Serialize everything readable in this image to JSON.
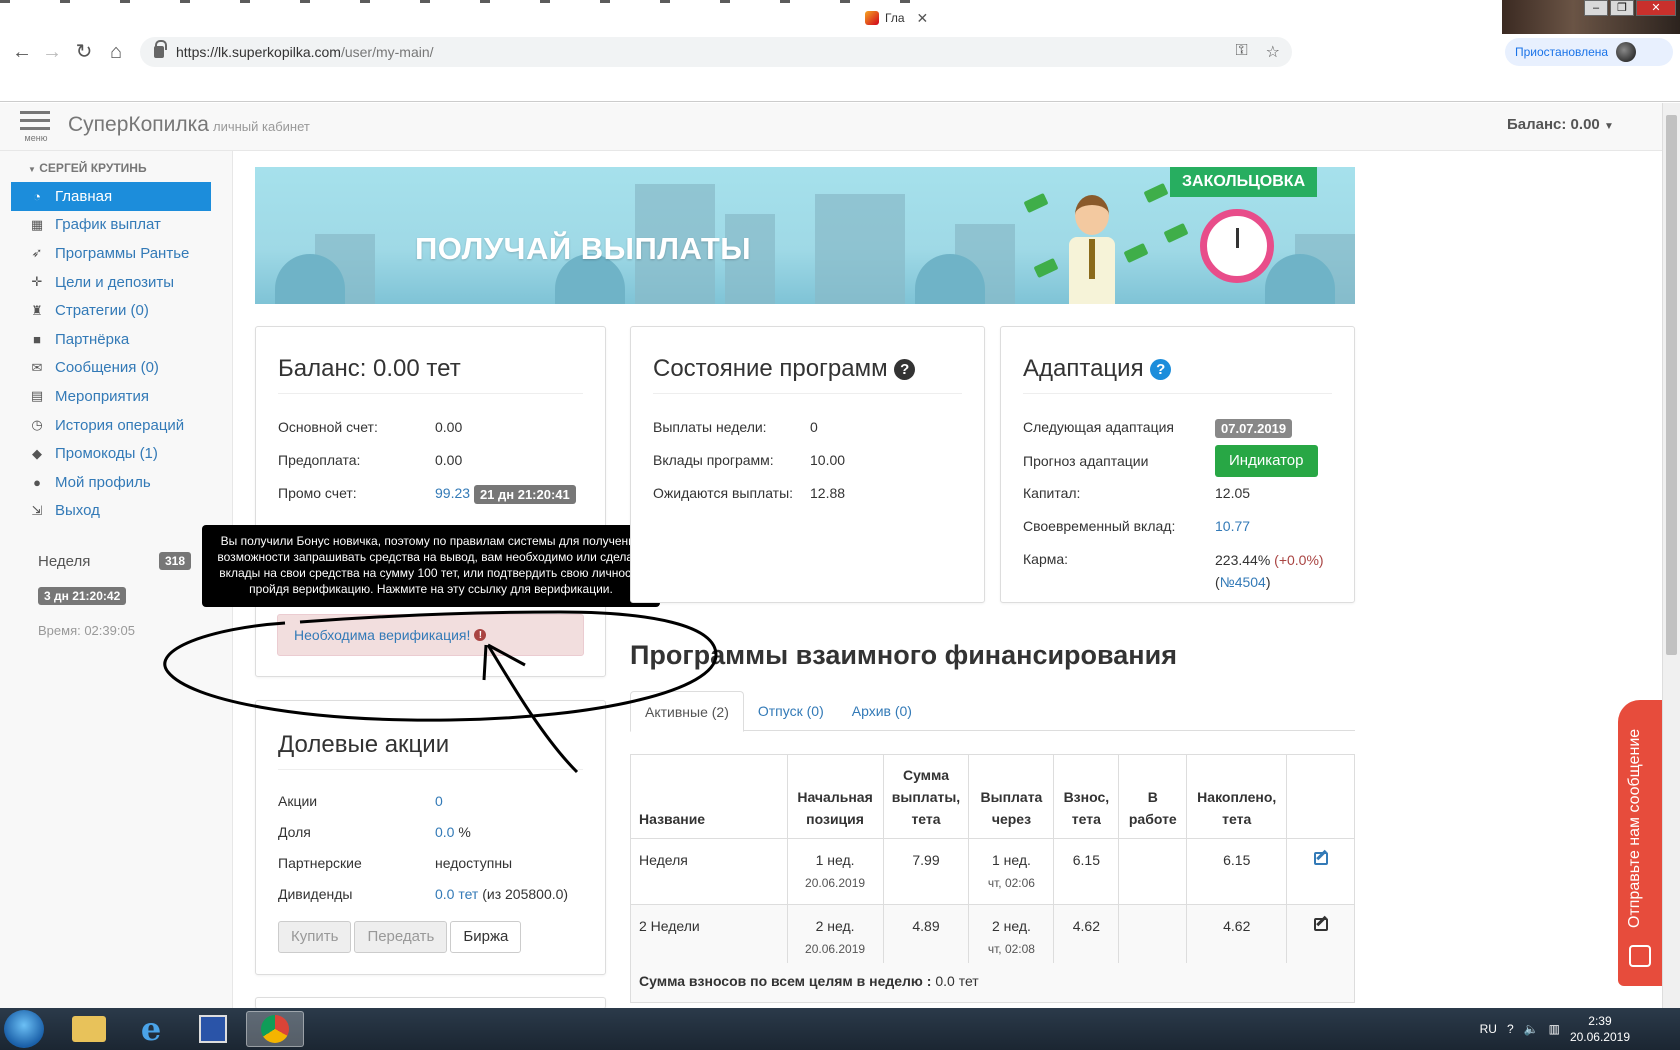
{
  "browser": {
    "tab_title": "Гла",
    "url_host": "https://lk.superkopilka.com",
    "url_path": "/user/my-main/",
    "profile_status": "Приостановлена"
  },
  "header": {
    "menu_label": "меню",
    "brand": "СуперКопилка",
    "brand_sub": "личный кабинет",
    "balance": "Баланс: 0.00"
  },
  "sidebar": {
    "user": "СЕРГЕЙ КРУТИНЬ",
    "items": [
      {
        "label": "Главная",
        "icon": "dashboard-icon",
        "glyph": "◔"
      },
      {
        "label": "График выплат",
        "icon": "calendar-icon",
        "glyph": "▦"
      },
      {
        "label": "Программы Рантье",
        "icon": "rocket-icon",
        "glyph": "➶"
      },
      {
        "label": "Цели и депозиты",
        "icon": "crosshair-icon",
        "glyph": "✛"
      },
      {
        "label": "Стратегии (0)",
        "icon": "chess-icon",
        "glyph": "♜"
      },
      {
        "label": "Партнёрка",
        "icon": "briefcase-icon",
        "glyph": "■"
      },
      {
        "label": "Сообщения (0)",
        "icon": "envelope-icon",
        "glyph": "✉"
      },
      {
        "label": "Мероприятия",
        "icon": "film-icon",
        "glyph": "▤"
      },
      {
        "label": "История операций",
        "icon": "clock-icon",
        "glyph": "◷"
      },
      {
        "label": "Промокоды (1)",
        "icon": "tag-icon",
        "glyph": "◆"
      },
      {
        "label": "Мой профиль",
        "icon": "user-icon",
        "glyph": "●"
      },
      {
        "label": "Выход",
        "icon": "logout-icon",
        "glyph": "⇲"
      }
    ],
    "week_label": "Неделя",
    "week_count": "318",
    "week_timer": "3 дн 21:20:42",
    "time_now": "Время: 02:39:05"
  },
  "banner": {
    "text": "ПОЛУЧАЙ ВЫПЛАТЫ",
    "tag": "ЗАКОЛЬЦОВКА"
  },
  "balance_panel": {
    "title": "Баланс: 0.00 тет",
    "main_label": "Основной счет:",
    "main_value": "0.00",
    "prepay_label": "Предоплата:",
    "prepay_value": "0.00",
    "promo_label": "Промо счет:",
    "promo_value": "99.23",
    "promo_timer": "21 дн 21:20:41",
    "tooltip": "Вы получили Бонус новичка, поэтому по правилам системы для получения возможности запрашивать средства на вывод, вам необходимо или сделать вклады на свои средства на сумму 100 тет, или подтвердить свою личность пройдя верификацию. Нажмите на эту ссылку для верификации.",
    "verify": "Необходима верификация!"
  },
  "shares_panel": {
    "title": "Долевые акции",
    "rows": [
      {
        "label": "Акции",
        "value": "0",
        "extra": ""
      },
      {
        "label": "Доля",
        "value": "0.0",
        "extra": "%"
      },
      {
        "label": "Партнерские",
        "value": "недоступны",
        "extra": ""
      },
      {
        "label": "Дивиденды",
        "value": "0.0 тет",
        "extra": "(из 205800.0)"
      }
    ],
    "btn_buy": "Купить",
    "btn_transfer": "Передать",
    "btn_exchange": "Биржа"
  },
  "status_panel": {
    "title": "Состояние программ",
    "rows": [
      {
        "label": "Выплаты недели:",
        "value": "0"
      },
      {
        "label": "Вклады программ:",
        "value": "10.00"
      },
      {
        "label": "Ожидаются выплаты:",
        "value": "12.88"
      }
    ]
  },
  "adapt_panel": {
    "title": "Адаптация",
    "next_label": "Следующая адаптация",
    "next_value": "07.07.2019",
    "forecast_label": "Прогноз адаптации",
    "forecast_btn": "Индикатор",
    "capital_label": "Капитал:",
    "capital_value": "12.05",
    "timely_label": "Своевременный вклад:",
    "timely_value": "10.77",
    "karma_label": "Карма:",
    "karma_value": "223.44%",
    "karma_delta": "(+0.0%)",
    "karma_rank_open": "(",
    "karma_rank": "№4504",
    "karma_rank_close": ")"
  },
  "programs": {
    "title": "Программы взаимного финансирования",
    "tabs": [
      "Активные (2)",
      "Отпуск (0)",
      "Архив (0)"
    ],
    "headers": [
      "Название",
      "Начальная позиция",
      "Сумма выплаты, тета",
      "Выплата через",
      "Взнос, тета",
      "В работе",
      "Накоплено, тета",
      ""
    ],
    "rows": [
      {
        "name": "Неделя",
        "start": "1 нед.",
        "start_date": "20.06.2019",
        "payout": "7.99",
        "through": "1 нед.",
        "through_sub": "чт, 02:06",
        "fee": "6.15",
        "inwork": "",
        "accum": "6.15"
      },
      {
        "name": "2 Недели",
        "start": "2 нед.",
        "start_date": "20.06.2019",
        "payout": "4.89",
        "through": "2 нед.",
        "through_sub": "чт, 02:08",
        "fee": "4.62",
        "inwork": "",
        "accum": "4.62"
      }
    ],
    "sum_label": "Сумма взносов по всем целям в неделю :",
    "sum_value": "0.0 тет"
  },
  "feedback": "Отправьте нам сообщение",
  "taskbar": {
    "lang": "RU",
    "time": "2:39",
    "date": "20.06.2019"
  },
  "colors": {
    "primary": "#337ab7",
    "active_nav": "#1c8ddb",
    "success": "#28a745",
    "danger": "#e74c3c"
  }
}
